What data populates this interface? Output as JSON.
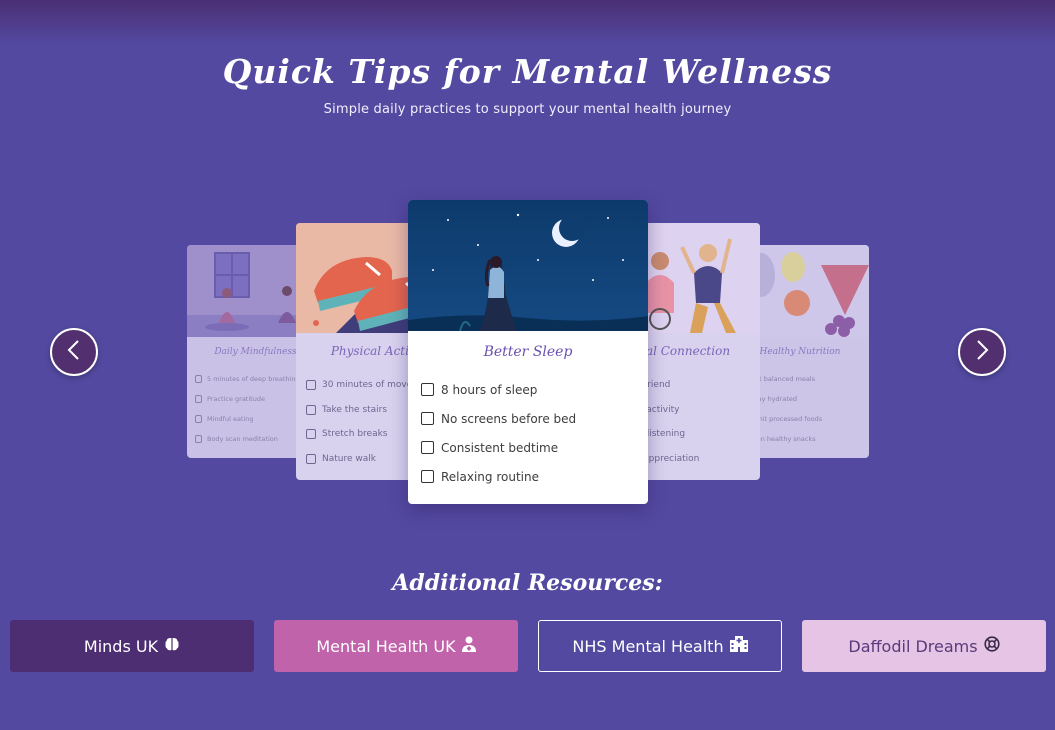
{
  "header": {
    "title": "Quick Tips for Mental Wellness",
    "subtitle": "Simple daily practices to support your mental health journey"
  },
  "carousel": {
    "cards": [
      {
        "id": "far-left",
        "title": "Daily Mindfulness",
        "tips": [
          "5 minutes of deep breathing",
          "Practice gratitude",
          "Mindful eating",
          "Body scan meditation"
        ]
      },
      {
        "id": "near-left",
        "title": "Physical Activity",
        "tips": [
          "30 minutes of movement",
          "Take the stairs",
          "Stretch breaks",
          "Nature walk"
        ]
      },
      {
        "id": "center",
        "title": "Better Sleep",
        "tips": [
          "8 hours of sleep",
          "No screens before bed",
          "Consistent bedtime",
          "Relaxing routine"
        ]
      },
      {
        "id": "near-right",
        "title": "Social Connection",
        "tips": [
          "Call a friend",
          "Group activity",
          "Active listening",
          "Show appreciation"
        ]
      },
      {
        "id": "far-right",
        "title": "Healthy Nutrition",
        "tips": [
          "Eat balanced meals",
          "Stay hydrated",
          "Limit processed foods",
          "Plan healthy snacks"
        ]
      }
    ],
    "prev_icon": "chevron-left-icon",
    "next_icon": "chevron-right-icon"
  },
  "resources": {
    "title": "Additional Resources:",
    "buttons": [
      {
        "label": "Minds UK",
        "icon": "brain-icon"
      },
      {
        "label": "Mental Health UK",
        "icon": "user-doctor-icon"
      },
      {
        "label": "NHS Mental Health",
        "icon": "hospital-icon"
      },
      {
        "label": "Daffodil Dreams",
        "icon": "life-ring-icon"
      }
    ]
  },
  "colors": {
    "background": "#5349a0",
    "accent_dark": "#4e2e72",
    "accent_pink": "#c063aa",
    "accent_light": "#e5c4e6",
    "card_title": "#6b4fb0"
  }
}
